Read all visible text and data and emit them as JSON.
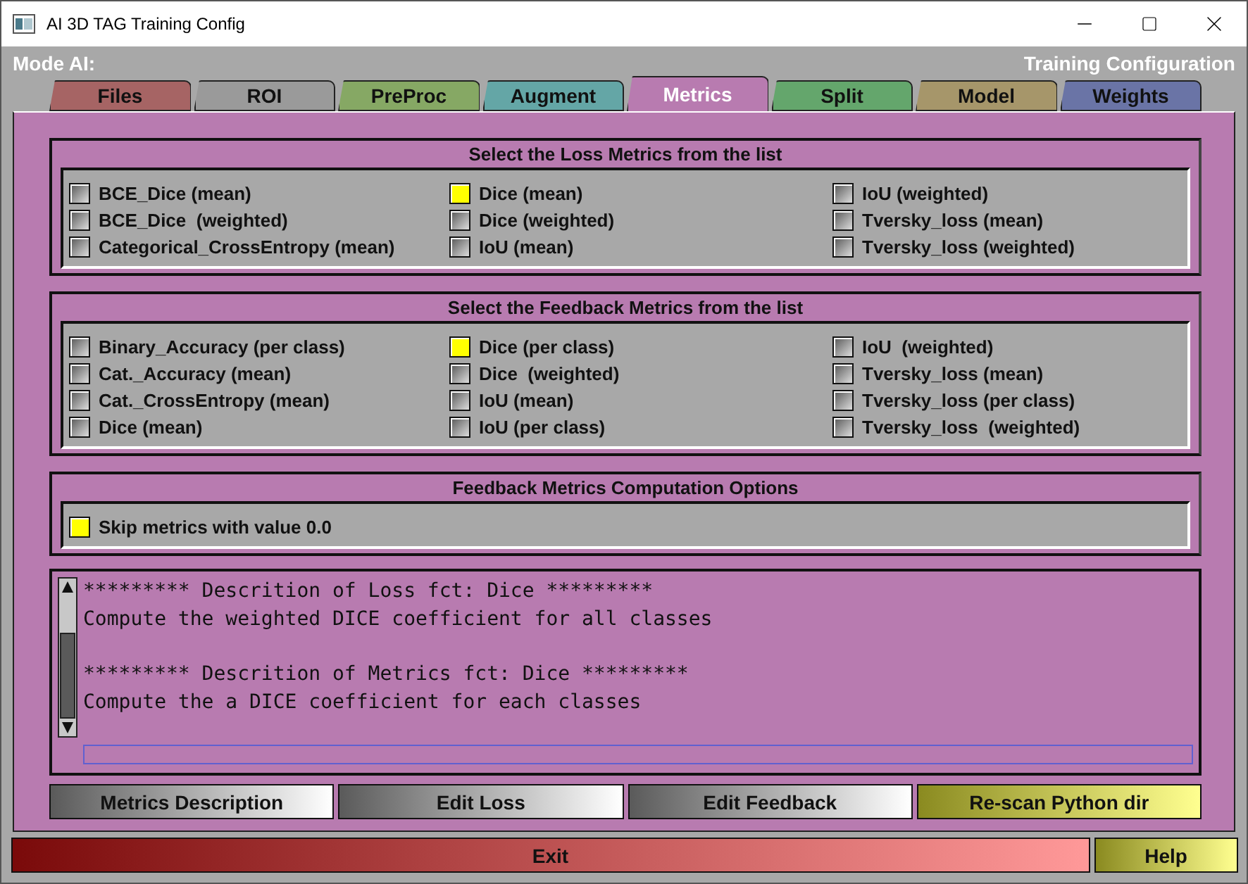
{
  "window": {
    "title": "AI 3D TAG Training Config"
  },
  "header": {
    "left": "Mode AI:",
    "right": "Training Configuration"
  },
  "tabs": [
    {
      "label": "Files",
      "color": "#a66464",
      "selected": false
    },
    {
      "label": "ROI",
      "color": "#9a9a9a",
      "selected": false
    },
    {
      "label": "PreProc",
      "color": "#86a864",
      "selected": false
    },
    {
      "label": "Augment",
      "color": "#64a6a6",
      "selected": false
    },
    {
      "label": "Metrics",
      "color": "#b87bb0",
      "selected": true
    },
    {
      "label": "Split",
      "color": "#64a66c",
      "selected": false
    },
    {
      "label": "Model",
      "color": "#a6966a",
      "selected": false
    },
    {
      "label": "Weights",
      "color": "#6a74a6",
      "selected": false
    }
  ],
  "groups": [
    {
      "title": "Select the Loss Metrics from the list",
      "columns": [
        [
          {
            "label": "BCE_Dice (mean)",
            "checked": false
          },
          {
            "label": "BCE_Dice  (weighted)",
            "checked": false
          },
          {
            "label": "Categorical_CrossEntropy (mean)",
            "checked": false
          }
        ],
        [
          {
            "label": "Dice (mean)",
            "checked": true
          },
          {
            "label": "Dice (weighted)",
            "checked": false
          },
          {
            "label": "IoU (mean)",
            "checked": false
          }
        ],
        [
          {
            "label": "IoU (weighted)",
            "checked": false
          },
          {
            "label": "Tversky_loss (mean)",
            "checked": false
          },
          {
            "label": "Tversky_loss (weighted)",
            "checked": false
          }
        ]
      ]
    },
    {
      "title": "Select the Feedback Metrics from the list",
      "columns": [
        [
          {
            "label": "Binary_Accuracy (per class)",
            "checked": false
          },
          {
            "label": "Cat._Accuracy (mean)",
            "checked": false
          },
          {
            "label": "Cat._CrossEntropy (mean)",
            "checked": false
          },
          {
            "label": "Dice (mean)",
            "checked": false
          }
        ],
        [
          {
            "label": "Dice (per class)",
            "checked": true
          },
          {
            "label": "Dice  (weighted)",
            "checked": false
          },
          {
            "label": "IoU (mean)",
            "checked": false
          },
          {
            "label": "IoU (per class)",
            "checked": false
          }
        ],
        [
          {
            "label": "IoU  (weighted)",
            "checked": false
          },
          {
            "label": "Tversky_loss (mean)",
            "checked": false
          },
          {
            "label": "Tversky_loss (per class)",
            "checked": false
          },
          {
            "label": "Tversky_loss  (weighted)",
            "checked": false
          }
        ]
      ]
    },
    {
      "title": "Feedback Metrics Computation Options",
      "columns": [
        [
          {
            "label": "Skip metrics with value 0.0",
            "checked": true
          }
        ]
      ]
    }
  ],
  "description": [
    [
      "********* Descrition of Loss fct: Dice *********",
      "Compute the weighted DICE coefficient for all classes"
    ],
    [
      "********* Descrition of Metrics fct: Dice *********",
      "Compute the a DICE coefficient for each classes"
    ]
  ],
  "buttons": [
    {
      "label": "Metrics Description",
      "kind": "grey"
    },
    {
      "label": "Edit Loss",
      "kind": "grey"
    },
    {
      "label": "Edit Feedback",
      "kind": "grey"
    },
    {
      "label": "Re-scan Python dir",
      "kind": "yellow"
    }
  ],
  "footer": [
    {
      "label": "Exit",
      "kind": "red"
    },
    {
      "label": "Help",
      "kind": "yellow"
    }
  ]
}
